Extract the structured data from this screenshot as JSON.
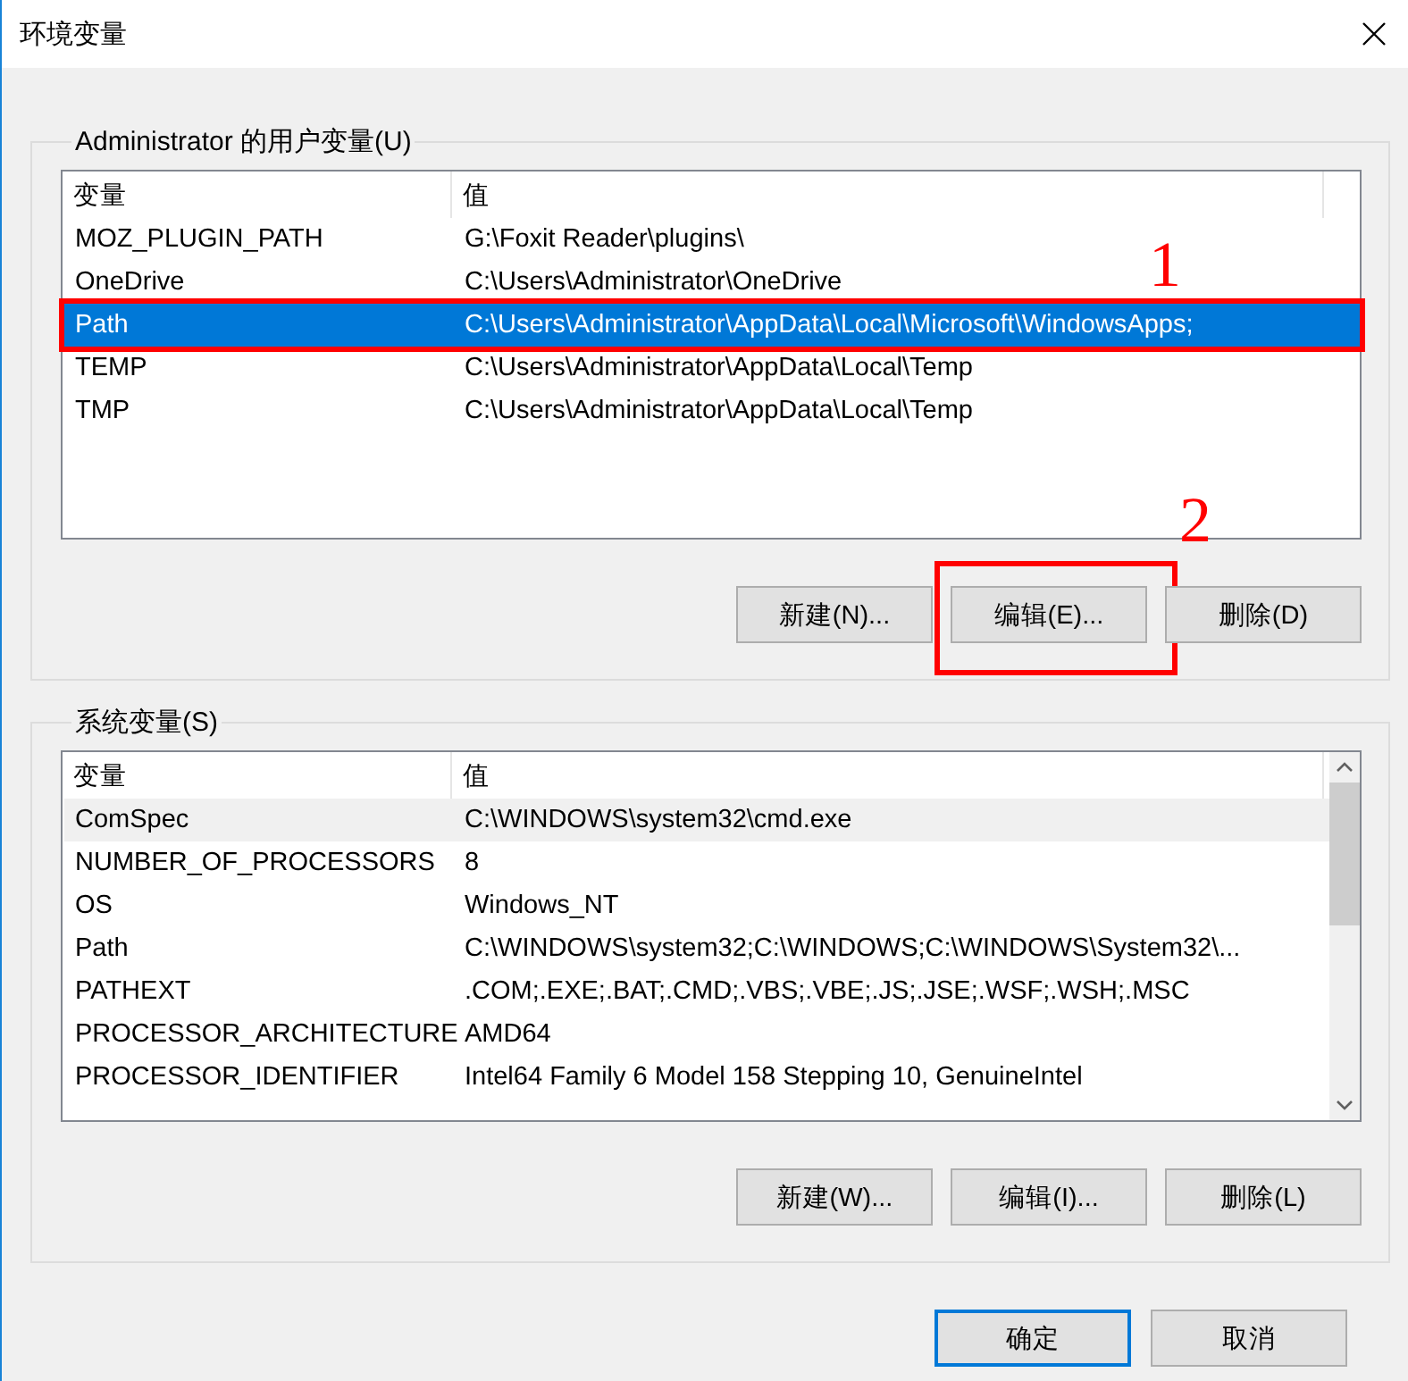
{
  "window": {
    "title": "环境变量"
  },
  "user_variables": {
    "title": "Administrator 的用户变量(U)",
    "columns": [
      "变量",
      "值"
    ],
    "rows": [
      {
        "name": "MOZ_PLUGIN_PATH",
        "value": "G:\\Foxit Reader\\plugins\\",
        "selected": false,
        "highlighted": false,
        "outlined": false
      },
      {
        "name": "OneDrive",
        "value": "C:\\Users\\Administrator\\OneDrive",
        "selected": false,
        "highlighted": false,
        "outlined": false
      },
      {
        "name": "Path",
        "value": "C:\\Users\\Administrator\\AppData\\Local\\Microsoft\\WindowsApps;",
        "selected": true,
        "highlighted": false,
        "outlined": true,
        "marker": "1"
      },
      {
        "name": "TEMP",
        "value": "C:\\Users\\Administrator\\AppData\\Local\\Temp",
        "selected": false,
        "highlighted": false,
        "outlined": false
      },
      {
        "name": "TMP",
        "value": "C:\\Users\\Administrator\\AppData\\Local\\Temp",
        "selected": false,
        "highlighted": false,
        "outlined": false
      }
    ],
    "buttons": [
      {
        "label": "新建(N)..."
      },
      {
        "label": "编辑(E)...",
        "outlined": true,
        "marker": "2"
      },
      {
        "label": "删除(D)"
      }
    ]
  },
  "system_variables": {
    "title": "系统变量(S)",
    "columns": [
      "变量",
      "值"
    ],
    "scrollbar": true,
    "rows": [
      {
        "name": "ComSpec",
        "value": "C:\\WINDOWS\\system32\\cmd.exe",
        "selected": false,
        "highlighted": true,
        "outlined": false
      },
      {
        "name": "NUMBER_OF_PROCESSORS",
        "value": "8",
        "selected": false,
        "highlighted": false,
        "outlined": false
      },
      {
        "name": "OS",
        "value": "Windows_NT",
        "selected": false,
        "highlighted": false,
        "outlined": false
      },
      {
        "name": "Path",
        "value": "C:\\WINDOWS\\system32;C:\\WINDOWS;C:\\WINDOWS\\System32\\...",
        "selected": false,
        "highlighted": false,
        "outlined": false
      },
      {
        "name": "PATHEXT",
        "value": ".COM;.EXE;.BAT;.CMD;.VBS;.VBE;.JS;.JSE;.WSF;.WSH;.MSC",
        "selected": false,
        "highlighted": false,
        "outlined": false
      },
      {
        "name": "PROCESSOR_ARCHITECTURE",
        "value": "AMD64",
        "selected": false,
        "highlighted": false,
        "outlined": false
      },
      {
        "name": "PROCESSOR_IDENTIFIER",
        "value": "Intel64 Family 6 Model 158 Stepping 10, GenuineIntel",
        "selected": false,
        "highlighted": false,
        "outlined": false
      }
    ],
    "buttons": [
      {
        "label": "新建(W)..."
      },
      {
        "label": "编辑(I)..."
      },
      {
        "label": "删除(L)"
      }
    ]
  },
  "dialog_buttons": [
    {
      "label": "确定",
      "default": true
    },
    {
      "label": "取消",
      "default": false
    }
  ]
}
